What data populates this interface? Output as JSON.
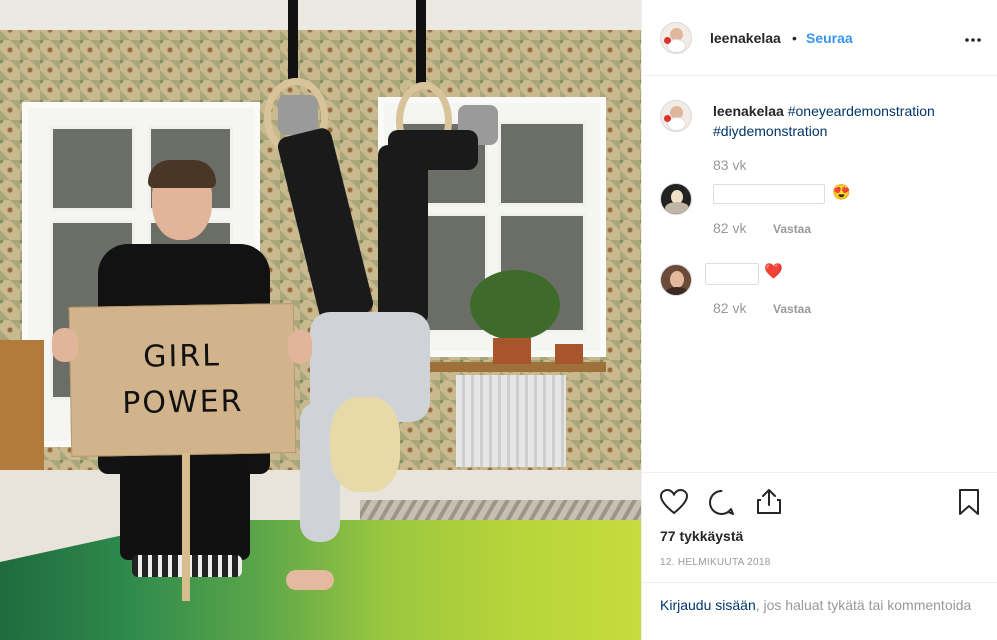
{
  "post": {
    "username": "leenakelaa",
    "separator": "•",
    "follow_label": "Seuraa",
    "more_label": "•••",
    "sign_lines": [
      "GIRL",
      "POWER"
    ],
    "caption": {
      "username": "leenakelaa",
      "hashtag1": "#oneyeardemonstration",
      "hashtag2": "#diydemonstration",
      "age": "83 vk"
    },
    "comments": [
      {
        "age": "82 vk",
        "reply_label": "Vastaa",
        "emoji": "😍"
      },
      {
        "age": "82 vk",
        "reply_label": "Vastaa",
        "emoji": "❤️"
      }
    ],
    "likes": "77 tykkäystä",
    "date": "12. HELMIKUUTA 2018",
    "login": {
      "link": "Kirjaudu sisään",
      "rest": ", jos haluat tykätä tai kommentoida"
    }
  },
  "colors": {
    "link": "#3897f0",
    "hashtag": "#003569",
    "muted": "#999999",
    "heart": "#e0245e"
  },
  "icons": [
    "like-heart-icon",
    "comment-icon",
    "share-icon",
    "bookmark-icon",
    "more-options-icon"
  ]
}
